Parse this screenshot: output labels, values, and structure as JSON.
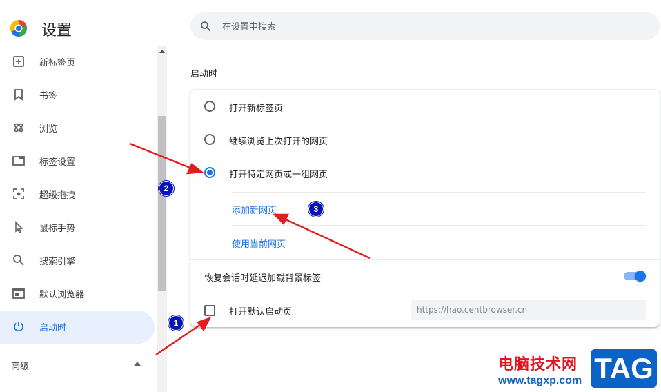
{
  "app": {
    "title": "设置"
  },
  "search": {
    "placeholder": "在设置中搜索"
  },
  "sidebar": {
    "items": [
      {
        "label": "新标签页",
        "icon": "new-tab-icon"
      },
      {
        "label": "书签",
        "icon": "bookmark-icon"
      },
      {
        "label": "浏览",
        "icon": "browse-icon"
      },
      {
        "label": "标签设置",
        "icon": "tab-settings-icon"
      },
      {
        "label": "超级拖拽",
        "icon": "super-drag-icon"
      },
      {
        "label": "鼠标手势",
        "icon": "mouse-gesture-icon"
      },
      {
        "label": "搜索引擎",
        "icon": "search-engine-icon"
      },
      {
        "label": "默认浏览器",
        "icon": "default-browser-icon"
      },
      {
        "label": "启动时",
        "icon": "power-icon",
        "active": true
      }
    ],
    "advanced_label": "高级"
  },
  "startup": {
    "section_title": "启动时",
    "options": [
      {
        "label": "打开新标签页",
        "checked": false
      },
      {
        "label": "继续浏览上次打开的网页",
        "checked": false
      },
      {
        "label": "打开特定网页或一组网页",
        "checked": true
      }
    ],
    "add_page_label": "添加新网页",
    "use_current_label": "使用当前网页",
    "lazy_load_label": "恢复会话时延迟加载背景标签",
    "lazy_load_enabled": true,
    "open_default_label": "打开默认启动页",
    "open_default_checked": false,
    "default_url_placeholder": "https://hao.centbrowser.cn"
  },
  "annotations": {
    "badge1": "1",
    "badge2": "2",
    "badge3": "3"
  },
  "watermark": {
    "site_name": "电脑技术网",
    "url": "www.tagxp.com",
    "logo_text": "TAG"
  },
  "colors": {
    "accent": "#1a73e8",
    "active_bg": "#e8f0fe",
    "arrow": "#e01e1e",
    "badge": "#0a14b4"
  }
}
